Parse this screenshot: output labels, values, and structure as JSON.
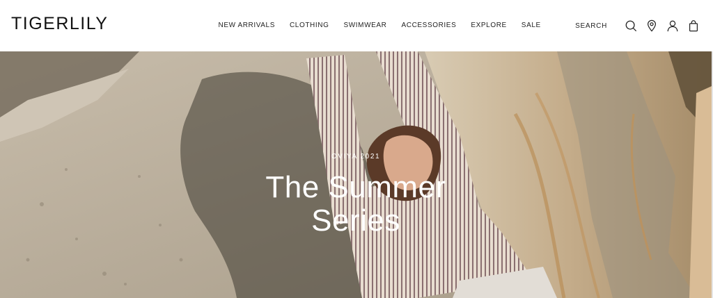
{
  "brand": {
    "logo_text": "TIGERLILY"
  },
  "nav": {
    "items": [
      {
        "label": "NEW ARRIVALS"
      },
      {
        "label": "CLOTHING"
      },
      {
        "label": "SWIMWEAR"
      },
      {
        "label": "ACCESSORIES"
      },
      {
        "label": "EXPLORE"
      },
      {
        "label": "SALE"
      }
    ]
  },
  "utilities": {
    "search_label": "SEARCH",
    "icons": [
      "search-icon",
      "location-pin-icon",
      "account-icon",
      "shopping-bag-icon"
    ]
  },
  "hero": {
    "eyebrow": "OVIYA 2021",
    "title_line1": "The Summer",
    "title_line2": "Series"
  },
  "colors": {
    "header_bg": "#ffffff",
    "text_dark": "#111111",
    "hero_text": "#ffffff",
    "rock": "#b3a897"
  }
}
